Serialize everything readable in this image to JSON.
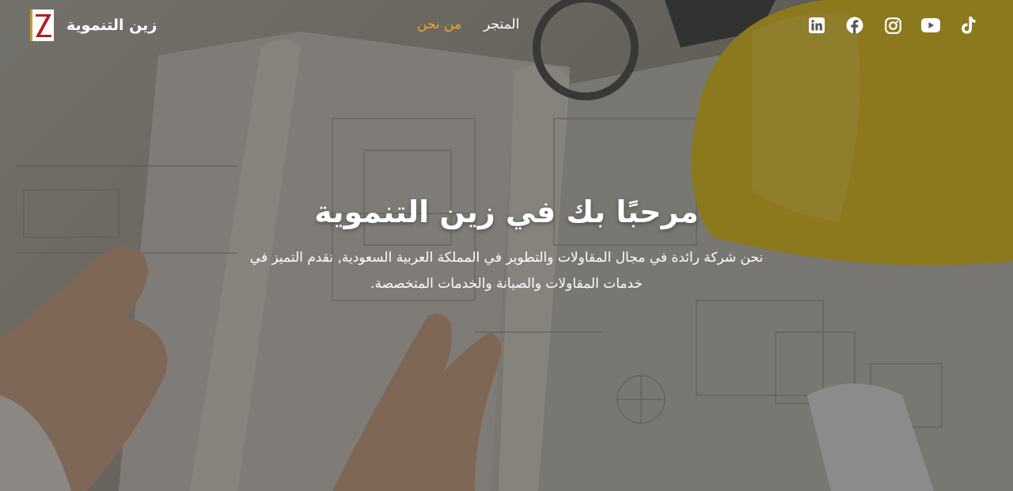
{
  "brand": {
    "name": "زين التنموية",
    "logo_letter": "Z"
  },
  "nav": {
    "items": [
      {
        "label": "من نحن",
        "active": true
      },
      {
        "label": "المتجر",
        "active": false
      }
    ]
  },
  "socials": [
    {
      "icon": "linkedin-icon"
    },
    {
      "icon": "facebook-icon"
    },
    {
      "icon": "instagram-icon"
    },
    {
      "icon": "youtube-icon"
    },
    {
      "icon": "tiktok-icon"
    }
  ],
  "hero": {
    "title": "مرحبًا بك في زين التنموية",
    "text": "نحن شركة رائدة في مجال المقاولات والتطوير في المملكة العربية السعودية, نقدم التميز في خدمات المقاولات والصيانة والخدمات المتخصصة."
  },
  "colors": {
    "accent": "#f5a623",
    "text": "#ffffff",
    "logo_red": "#b01e23"
  }
}
